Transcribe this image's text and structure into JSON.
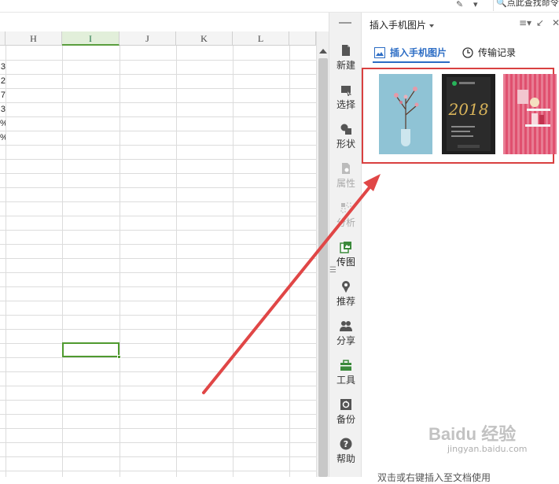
{
  "topbar": {
    "search_text": "点此查找命令"
  },
  "sheet": {
    "columns": [
      "H",
      "I",
      "J",
      "K",
      "L"
    ],
    "active_column": "I",
    "partial_values": [
      "3",
      "2",
      "7",
      "3",
      "%",
      "%"
    ]
  },
  "side_toolbar": {
    "items": [
      {
        "label": "新建",
        "icon": "file-new-icon"
      },
      {
        "label": "选择",
        "icon": "select-icon"
      },
      {
        "label": "形状",
        "icon": "shape-icon"
      },
      {
        "label": "属性",
        "icon": "properties-icon"
      },
      {
        "label": "分析",
        "icon": "analysis-icon"
      },
      {
        "label": "传图",
        "icon": "transfer-image-icon"
      },
      {
        "label": "推荐",
        "icon": "recommend-icon"
      },
      {
        "label": "分享",
        "icon": "share-icon"
      },
      {
        "label": "工具",
        "icon": "toolbox-icon"
      },
      {
        "label": "备份",
        "icon": "backup-icon"
      },
      {
        "label": "帮助",
        "icon": "help-icon"
      }
    ]
  },
  "panel": {
    "title": "插入手机图片",
    "tabs": [
      {
        "label": "插入手机图片",
        "active": true
      },
      {
        "label": "传输记录",
        "active": false
      }
    ],
    "thumbnail_text": "2018",
    "footer": "双击或右键插入至文档使用"
  },
  "watermark": {
    "brand": "Baidu 经验",
    "url": "jingyan.baidu.com"
  },
  "colors": {
    "accent_green": "#4f9a2f",
    "annotation_red": "#d94040",
    "tab_blue": "#2b6cc4"
  }
}
